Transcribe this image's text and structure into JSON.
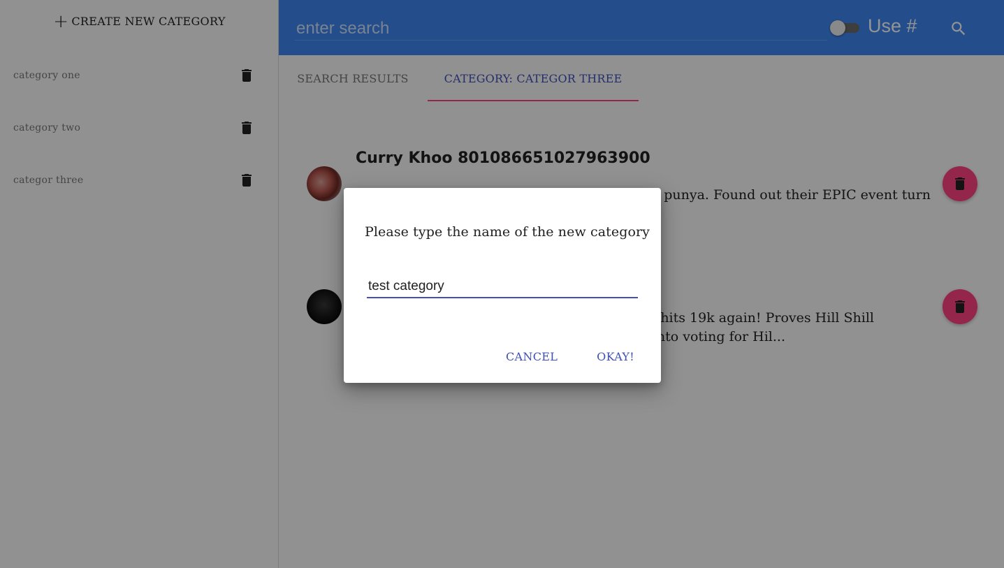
{
  "sidebar": {
    "create_label": "CREATE NEW CATEGORY",
    "create_icon": "plus-icon",
    "categories": [
      {
        "label": "category one"
      },
      {
        "label": "category two"
      },
      {
        "label": "categor three"
      }
    ]
  },
  "header": {
    "search_placeholder": "enter search",
    "toggle_label": "Use #",
    "toggle_on": false,
    "search_icon": "search-icon",
    "bg_color": "#3f87ef"
  },
  "tabs": [
    {
      "label": "SEARCH RESULTS",
      "active": false
    },
    {
      "label": "CATEGORY: CATEGOR THREE",
      "active": true
    }
  ],
  "tweets": [
    {
      "author": "Curry Khoo 801086651027963900",
      "text": "ri punya. Found out their EPIC event turn"
    },
    {
      "author": "",
      "text_line1": "W hits 19k again! Proves Hill Shill",
      "text_line2": "nto voting for Hil..."
    }
  ],
  "dialog": {
    "title": "Please type the name of the new category",
    "input_value": "test category",
    "cancel_label": "CANCEL",
    "okay_label": "OKAY!"
  },
  "colors": {
    "accent": "#3f51b5",
    "pink": "#ff4081",
    "header": "#3f87ef"
  }
}
